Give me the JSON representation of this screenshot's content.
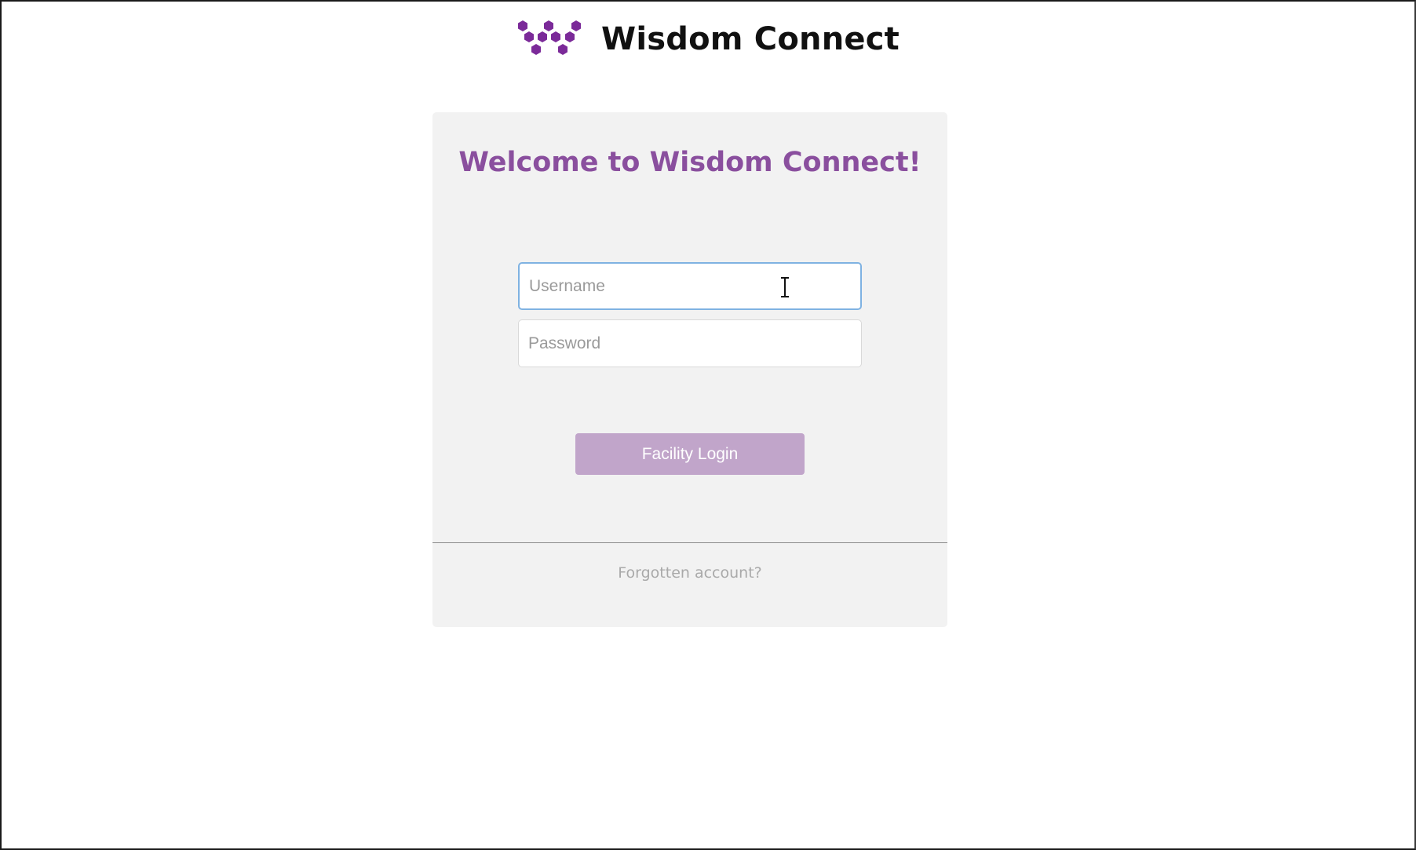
{
  "header": {
    "app_title": "Wisdom Connect",
    "logo_icon": "hexagon-cluster-logo-icon"
  },
  "login_card": {
    "heading": "Welcome to Wisdom Connect!",
    "username_placeholder": "Username",
    "username_value": "",
    "password_placeholder": "Password",
    "password_value": "",
    "login_button_label": "Facility Login",
    "forgot_link_label": "Forgotten account?"
  },
  "colors": {
    "brand_purple": "#7b2a99",
    "heading_purple": "#8a4f9e",
    "button_purple": "#c1a5ca",
    "card_bg": "#f2f2f2",
    "focus_border": "#7fb2e2"
  },
  "cursor": {
    "type": "text-cursor-icon"
  }
}
